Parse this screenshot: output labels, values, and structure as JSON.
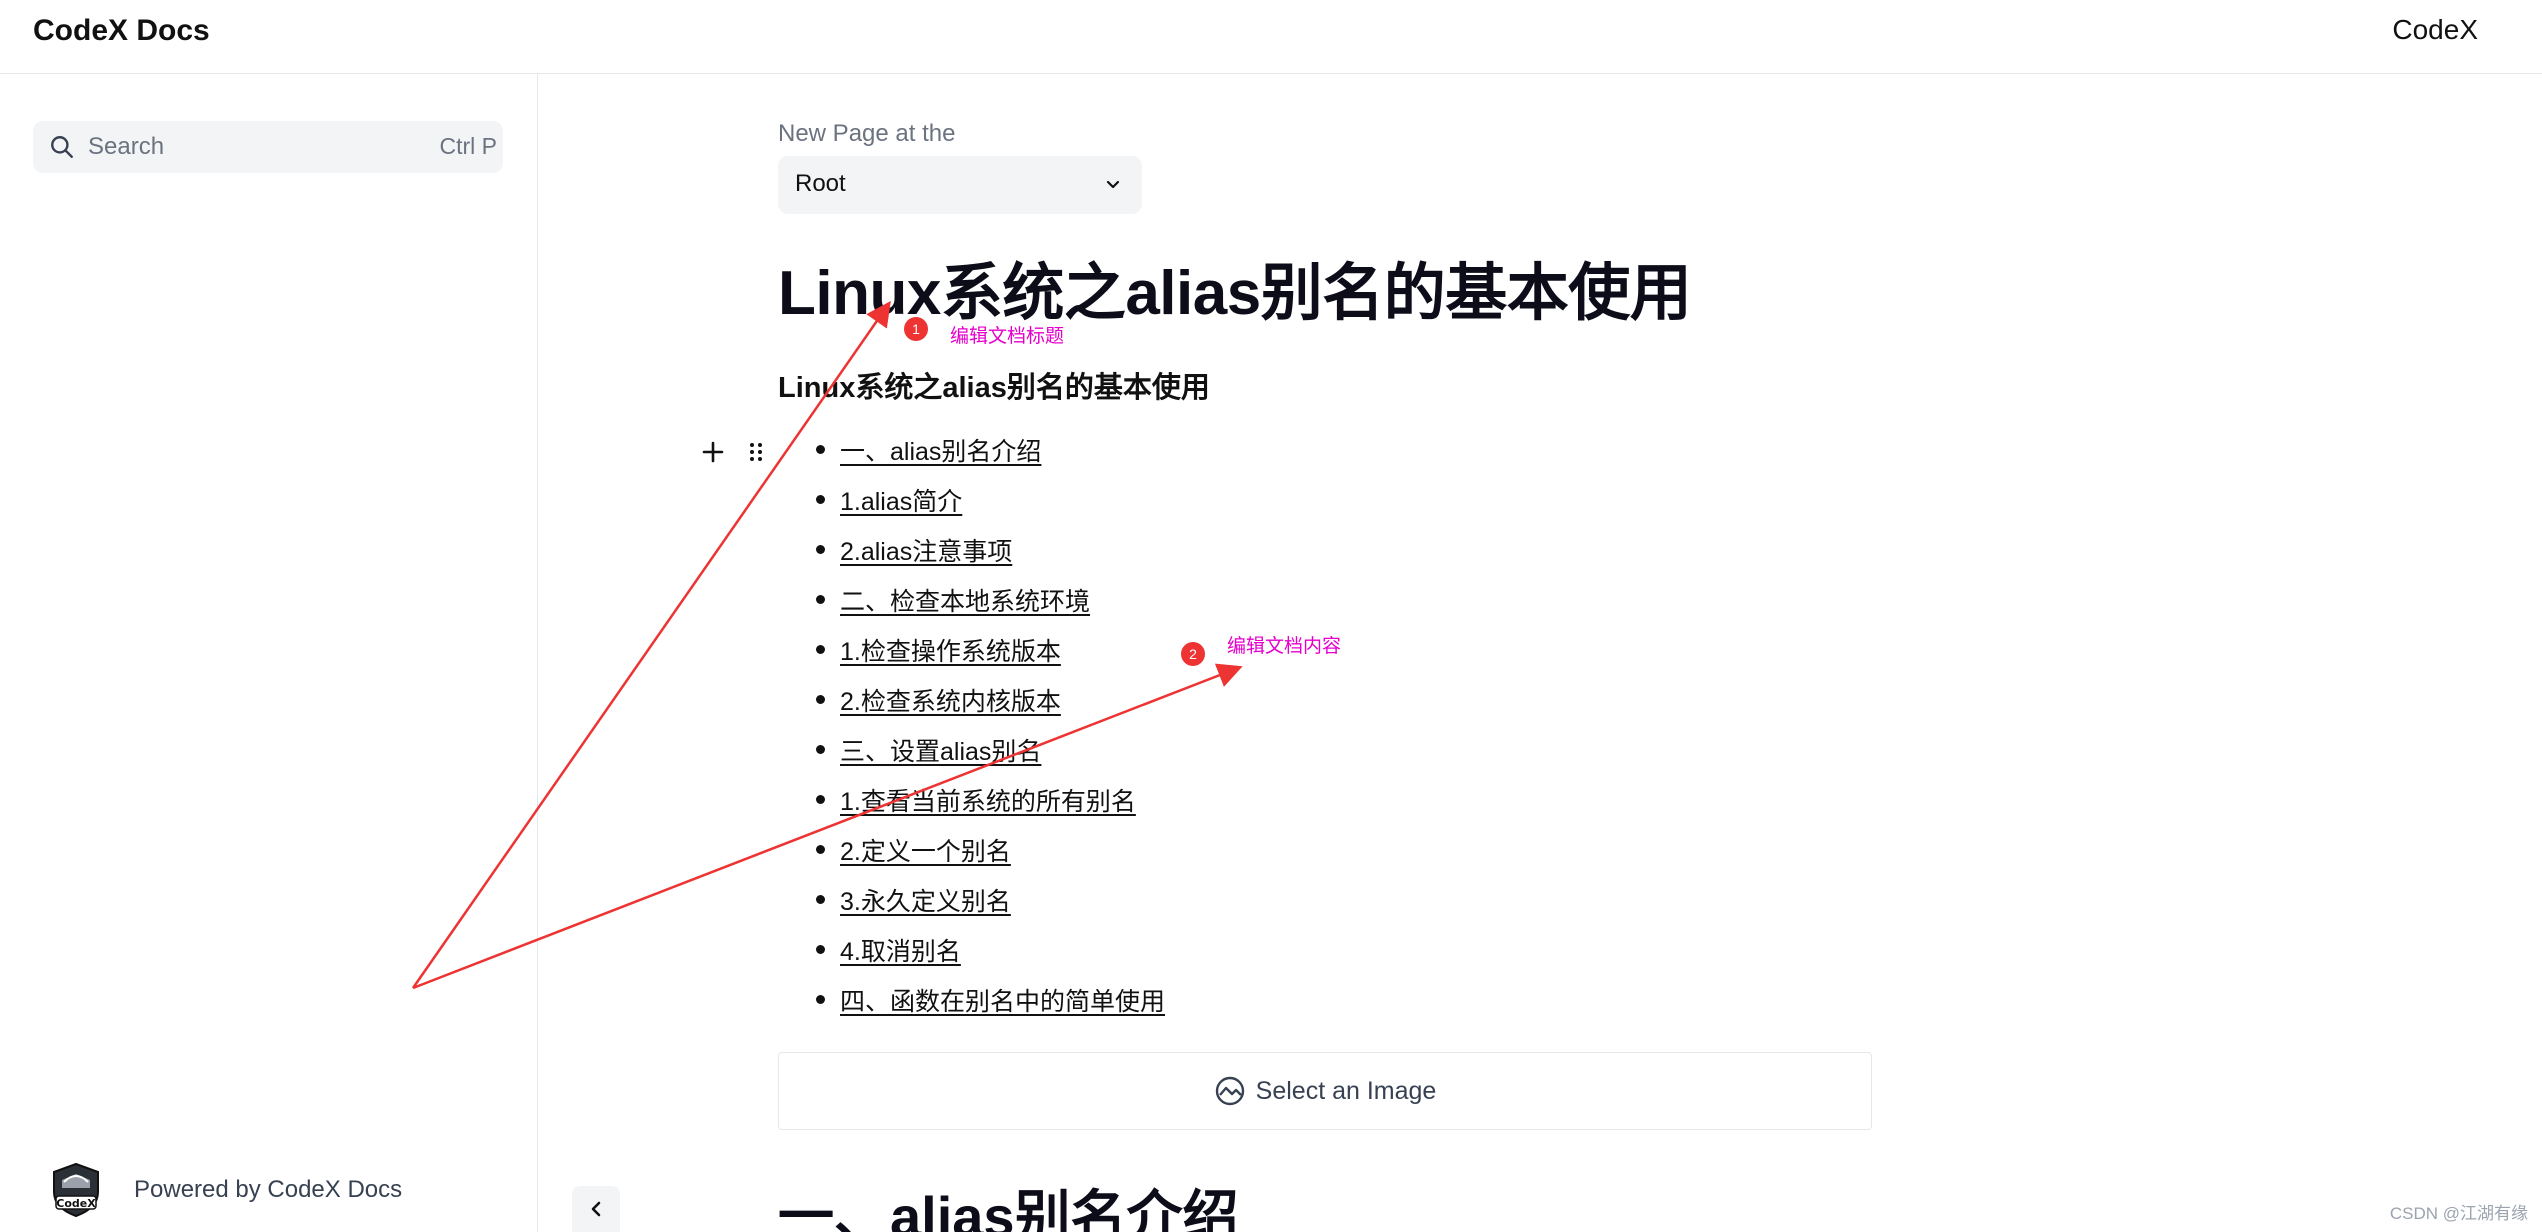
{
  "header": {
    "brand": "CodeX Docs",
    "right_link": "CodeX"
  },
  "sidebar": {
    "search": {
      "placeholder": "Search",
      "shortcut": "Ctrl P"
    },
    "footer": {
      "logo_text": "CodeX",
      "powered_by": "Powered by CodeX Docs"
    }
  },
  "main": {
    "new_page_label": "New Page at the",
    "parent_select": {
      "selected": "Root"
    },
    "title": "Linux系统之alias别名的基本使用",
    "subtitle": "Linux系统之alias别名的基本使用",
    "toc": [
      "一、alias别名介绍",
      "1.alias简介",
      "2.alias注意事项",
      "二、检查本地系统环境",
      "1.检查操作系统版本",
      "2.检查系统内核版本",
      "三、设置alias别名",
      "1.查看当前系统的所有别名",
      "2.定义一个别名",
      "3.永久定义别名",
      "4.取消别名",
      "四、函数在别名中的简单使用"
    ],
    "image_block_label": "Select an Image",
    "section_heading": "一、alias别名介绍"
  },
  "annotations": [
    {
      "badge": "1",
      "text": "编辑文档标题"
    },
    {
      "badge": "2",
      "text": "编辑文档内容"
    }
  ],
  "watermark": "CSDN @江湖有缘",
  "colors": {
    "annotation_arrow": "#ee3333",
    "annotation_text": "#e600cc",
    "surface": "#f3f4f6",
    "border": "#e5e7eb"
  }
}
